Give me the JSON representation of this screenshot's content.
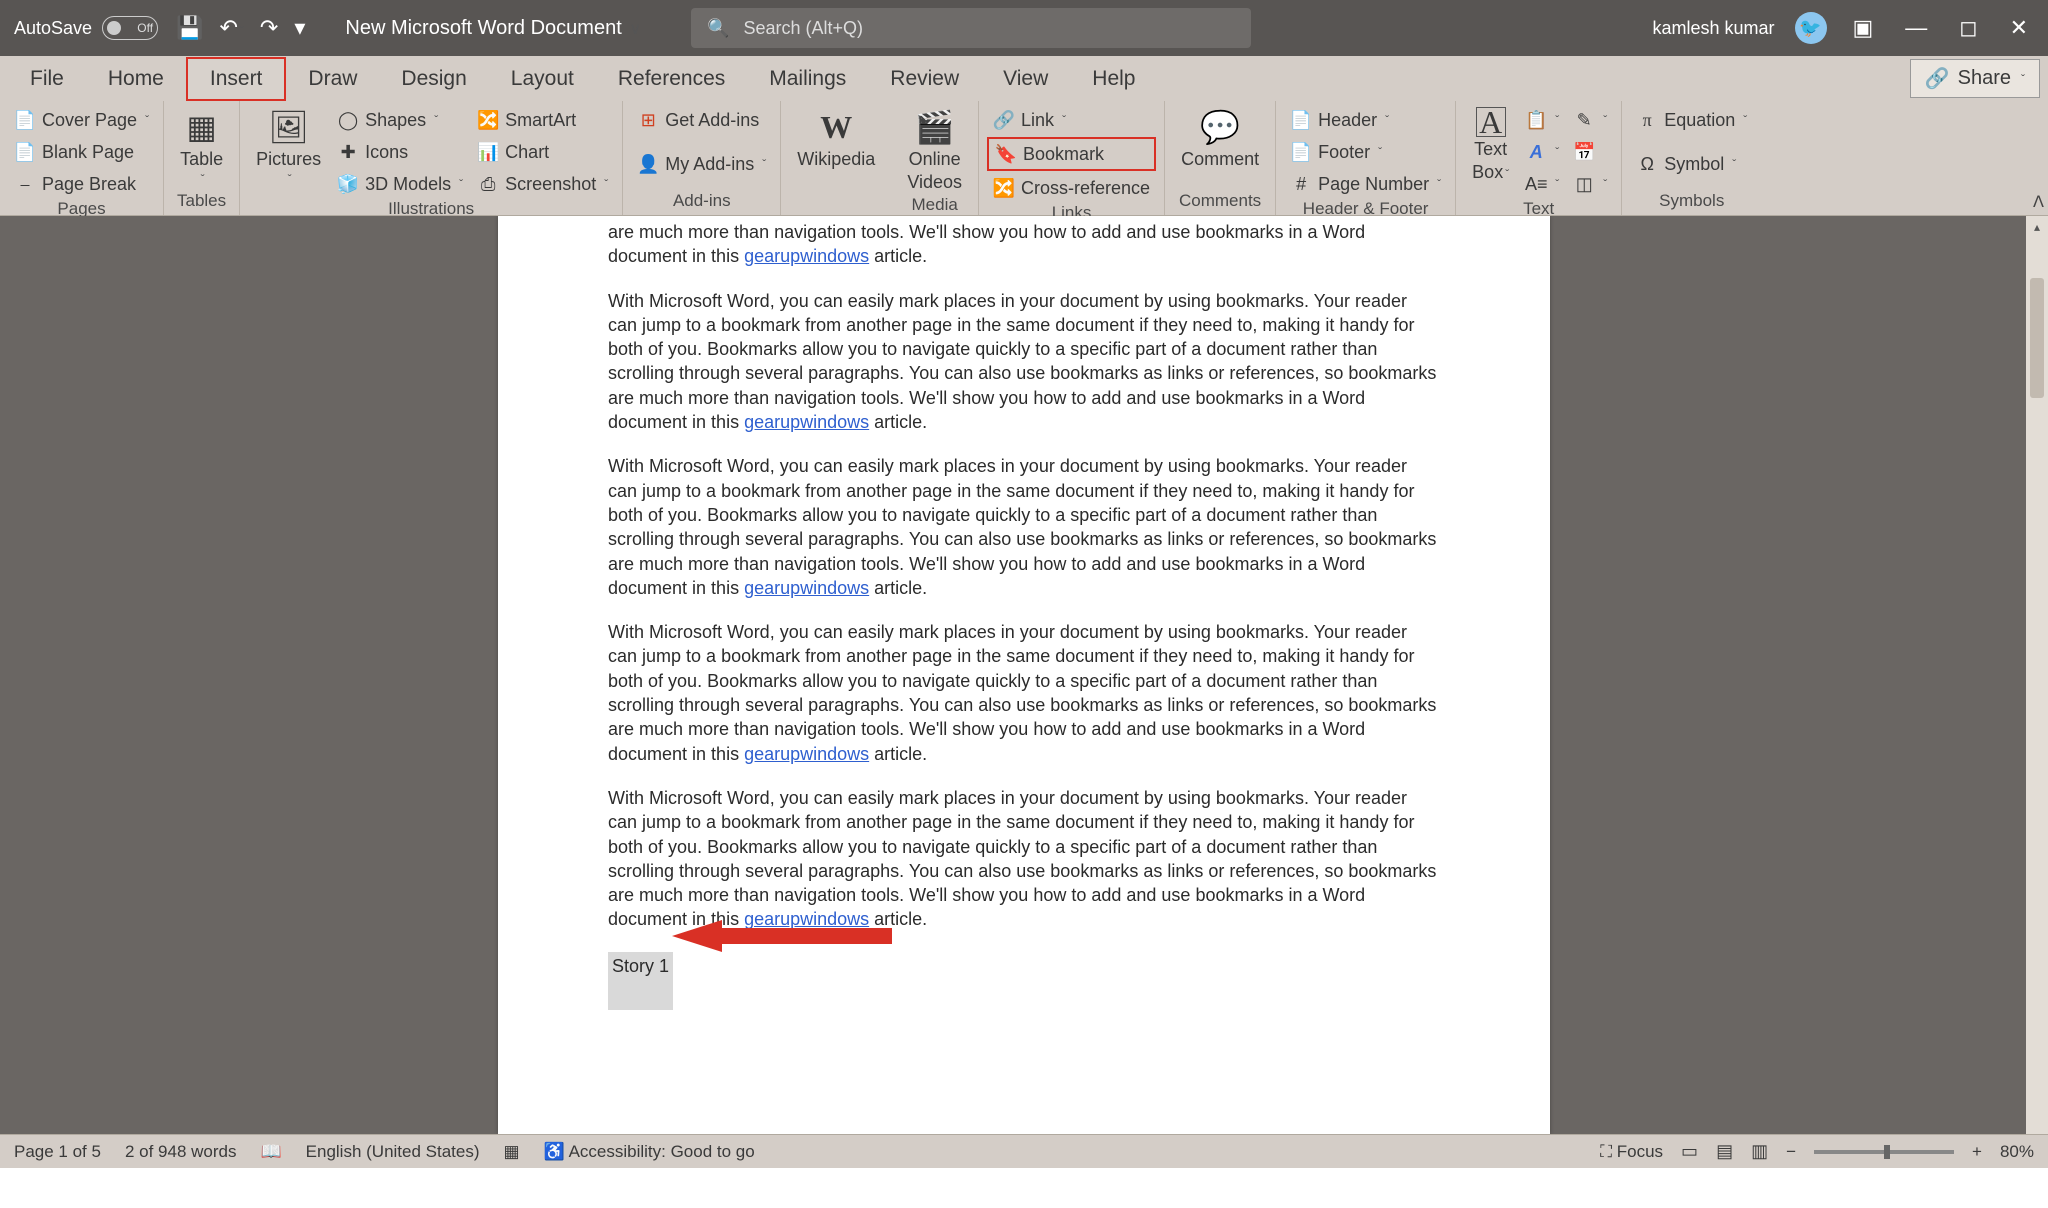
{
  "titlebar": {
    "autosave_label": "AutoSave",
    "autosave_state": "Off",
    "doc_title": "New Microsoft Word Document",
    "search_placeholder": "Search (Alt+Q)",
    "user_name": "kamlesh kumar"
  },
  "tabs": {
    "file": "File",
    "home": "Home",
    "insert": "Insert",
    "draw": "Draw",
    "design": "Design",
    "layout": "Layout",
    "references": "References",
    "mailings": "Mailings",
    "review": "Review",
    "view": "View",
    "help": "Help",
    "share": "Share"
  },
  "ribbon": {
    "pages": {
      "label": "Pages",
      "cover_page": "Cover Page",
      "blank_page": "Blank Page",
      "page_break": "Page Break"
    },
    "tables": {
      "label": "Tables",
      "table": "Table"
    },
    "illustrations": {
      "label": "Illustrations",
      "pictures": "Pictures",
      "shapes": "Shapes",
      "icons": "Icons",
      "models3d": "3D Models",
      "smartart": "SmartArt",
      "chart": "Chart",
      "screenshot": "Screenshot"
    },
    "addins": {
      "label": "Add-ins",
      "get_addins": "Get Add-ins",
      "my_addins": "My Add-ins"
    },
    "media": {
      "label": "Media",
      "wikipedia": "Wikipedia",
      "online_videos_1": "Online",
      "online_videos_2": "Videos"
    },
    "links": {
      "label": "Links",
      "link": "Link",
      "bookmark": "Bookmark",
      "cross_reference": "Cross-reference"
    },
    "comments": {
      "label": "Comments",
      "comment": "Comment"
    },
    "header_footer": {
      "label": "Header & Footer",
      "header": "Header",
      "footer": "Footer",
      "page_number": "Page Number"
    },
    "text": {
      "label": "Text",
      "text_box_1": "Text",
      "text_box_2": "Box"
    },
    "symbols": {
      "label": "Symbols",
      "equation": "Equation",
      "symbol": "Symbol"
    }
  },
  "document": {
    "paragraph_intro": "are much more than navigation tools. We'll show you how to add and use bookmarks in a Word document in this ",
    "link_text": "gearupwindows",
    "paragraph_end": " article.",
    "full_paragraph_a": "With Microsoft Word, you can easily mark places in your document by using bookmarks. Your reader can jump to a bookmark from another page in the same document if they need to, making it handy for both of you. Bookmarks allow you to navigate quickly to a specific part of a document rather than scrolling through several paragraphs. You can also use bookmarks as links or references, so bookmarks are much more than navigation tools. We'll show you how to add and use bookmarks in a Word document in this ",
    "story_label": "Story 1"
  },
  "statusbar": {
    "page": "Page 1 of 5",
    "words": "2 of 948 words",
    "language": "English (United States)",
    "accessibility": "Accessibility: Good to go",
    "focus": "Focus",
    "zoom": "80%"
  }
}
